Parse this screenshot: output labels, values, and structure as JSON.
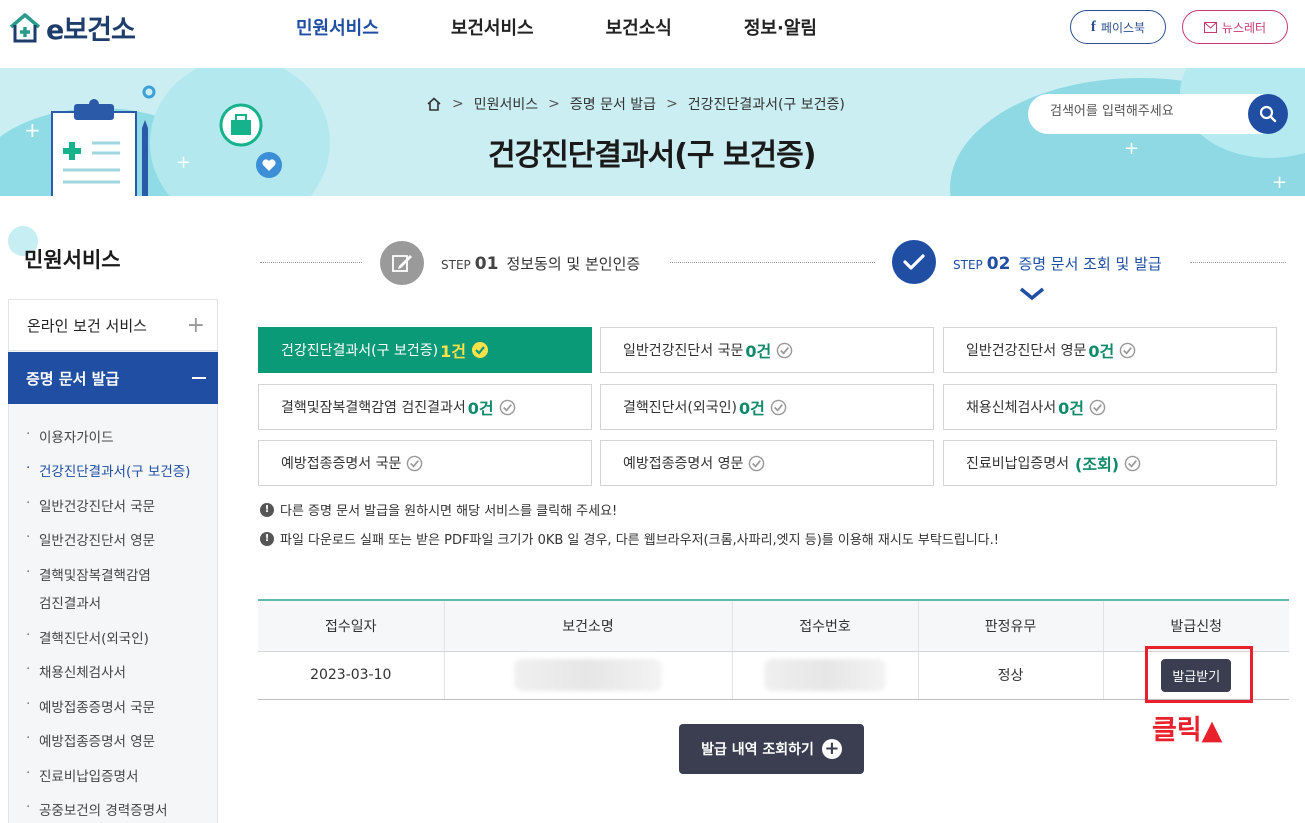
{
  "header": {
    "logo_text": "e보건소",
    "nav": [
      "민원서비스",
      "보건서비스",
      "보건소식",
      "정보·알림"
    ],
    "facebook_label": "페이스북",
    "newsletter_label": "뉴스레터"
  },
  "banner": {
    "breadcrumb": [
      "민원서비스",
      "증명 문서 발급",
      "건강진단결과서(구 보건증)"
    ],
    "title": "건강진단결과서(구 보건증)",
    "search_placeholder": "검색어를 입력해주세요"
  },
  "sidebar": {
    "title": "민원서비스",
    "section1": "온라인 보건 서비스",
    "section2": "증명 문서 발급",
    "items": [
      "이용자가이드",
      "건강진단결과서(구 보건증)",
      "일반건강진단서 국문",
      "일반건강진단서 영문",
      "결핵및잠복결핵감염",
      "검진결과서",
      "결핵진단서(외국인)",
      "채용신체검사서",
      "예방접종증명서 국문",
      "예방접종증명서 영문",
      "진료비납입증명서",
      "공중보건의 경력증명서"
    ]
  },
  "steps": [
    {
      "small": "STEP",
      "num": "01",
      "text": "정보동의 및 본인인증"
    },
    {
      "small": "STEP",
      "num": "02",
      "text": "증명 문서 조회 및 발급"
    }
  ],
  "services": [
    {
      "label": "건강진단결과서(구 보건증)",
      "count": "1건"
    },
    {
      "label": "일반건강진단서 국문",
      "count": "0건"
    },
    {
      "label": "일반건강진단서 영문",
      "count": "0건"
    },
    {
      "label": "결핵및잠복결핵감염 검진결과서",
      "count": "0건"
    },
    {
      "label": "결핵진단서(외국인)",
      "count": "0건"
    },
    {
      "label": "채용신체검사서",
      "count": "0건"
    },
    {
      "label": "예방접종증명서 국문",
      "count": ""
    },
    {
      "label": "예방접종증명서 영문",
      "count": ""
    },
    {
      "label": "진료비납입증명서",
      "count": "(조회)"
    }
  ],
  "notices": [
    "다른 증명 문서 발급을 원하시면 해당 서비스를 클릭해 주세요!",
    "파일 다운로드 실패 또는 받은 PDF파일 크기가 0KB 일 경우, 다른 웹브라우저(크롬,사파리,엣지 등)를 이용해 재시도 부탁드립니다.!"
  ],
  "table": {
    "headers": [
      "접수일자",
      "보건소명",
      "접수번호",
      "판정유무",
      "발급신청"
    ],
    "row": {
      "date": "2023-03-10",
      "status": "정상",
      "button": "발급받기"
    }
  },
  "annotation": "클릭▲",
  "history_button": "발급 내역 조회하기",
  "colors": {
    "primary": "#1f4ea3",
    "green": "#0b9a78",
    "highlight": "#e8212c",
    "banner": "#cbeef3"
  }
}
